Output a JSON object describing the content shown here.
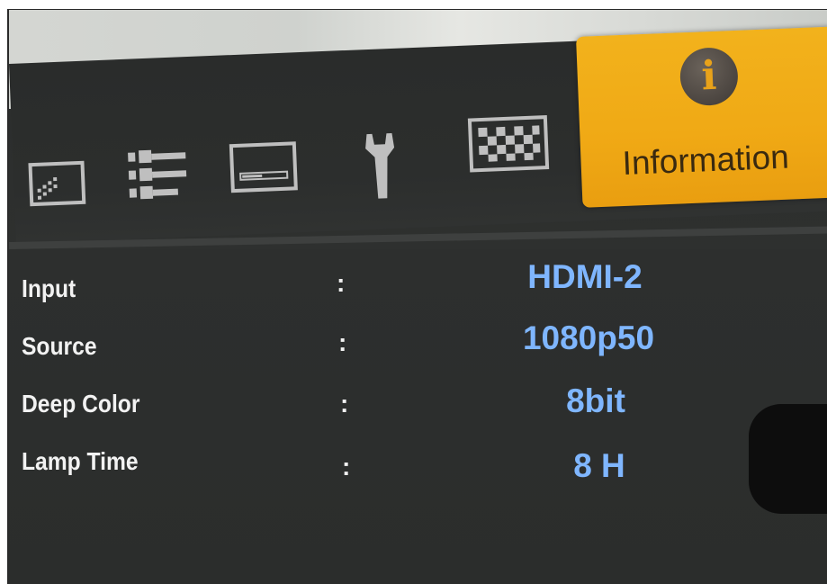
{
  "menu": {
    "tabs": [
      {
        "icon": "picture-icon"
      },
      {
        "icon": "input-settings-icon"
      },
      {
        "icon": "display-icon"
      },
      {
        "icon": "wrench-icon"
      },
      {
        "icon": "test-pattern-icon"
      },
      {
        "icon": "information-icon",
        "label": "Information",
        "active": true
      }
    ],
    "active_color": "#f0a915"
  },
  "info": {
    "rows": [
      {
        "label": "Input",
        "separator": ":",
        "value": "HDMI-2"
      },
      {
        "label": "Source",
        "separator": ":",
        "value": "1080p50"
      },
      {
        "label": "Deep Color",
        "separator": ":",
        "value": "8bit"
      },
      {
        "label": "Lamp Time",
        "separator": ":",
        "value": "8 H"
      }
    ],
    "value_color": "#7fb6ff"
  }
}
